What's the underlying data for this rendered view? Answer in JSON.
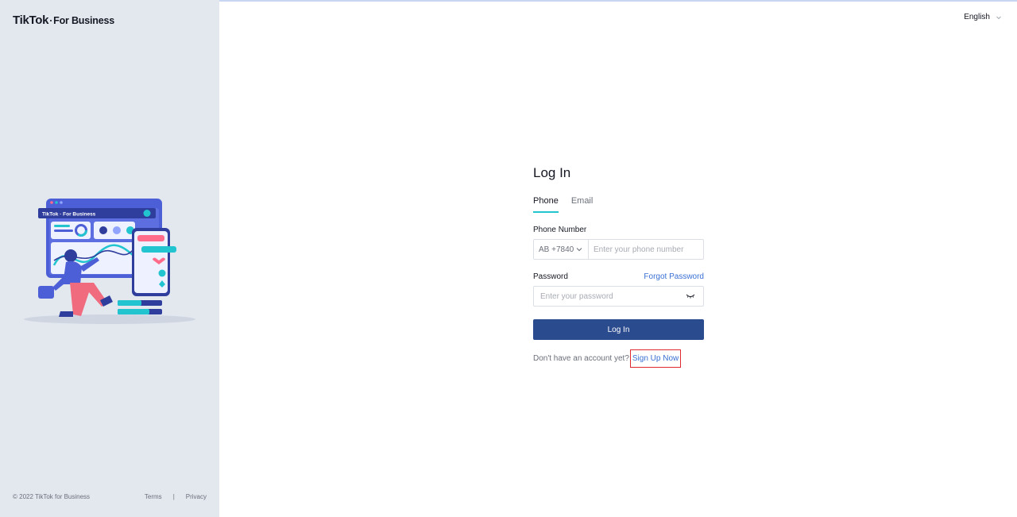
{
  "brand": {
    "logo_main": "TikTok",
    "logo_sub": "For Business"
  },
  "header": {
    "language": "English"
  },
  "login": {
    "title": "Log In",
    "tabs": [
      {
        "label": "Phone",
        "active": true
      },
      {
        "label": "Email",
        "active": false
      }
    ],
    "phone_label": "Phone Number",
    "country_code": "AB +7840",
    "phone_placeholder": "Enter your phone number",
    "password_label": "Password",
    "forgot_password": "Forgot Password",
    "password_placeholder": "Enter your password",
    "submit_label": "Log In",
    "no_account_text": "Don't have an account yet?",
    "signup_link": "Sign Up Now"
  },
  "illustration": {
    "badge_text": "TikTok · For Business"
  },
  "footer": {
    "copyright": "© 2022 TikTok for Business",
    "terms": "Terms",
    "separator": "|",
    "privacy": "Privacy"
  },
  "colors": {
    "sidebar_bg": "#e3e8ef",
    "accent_teal": "#21c4cf",
    "primary_button": "#2b4b8f",
    "link": "#3a6fd4",
    "highlight_box": "#e0292e"
  }
}
